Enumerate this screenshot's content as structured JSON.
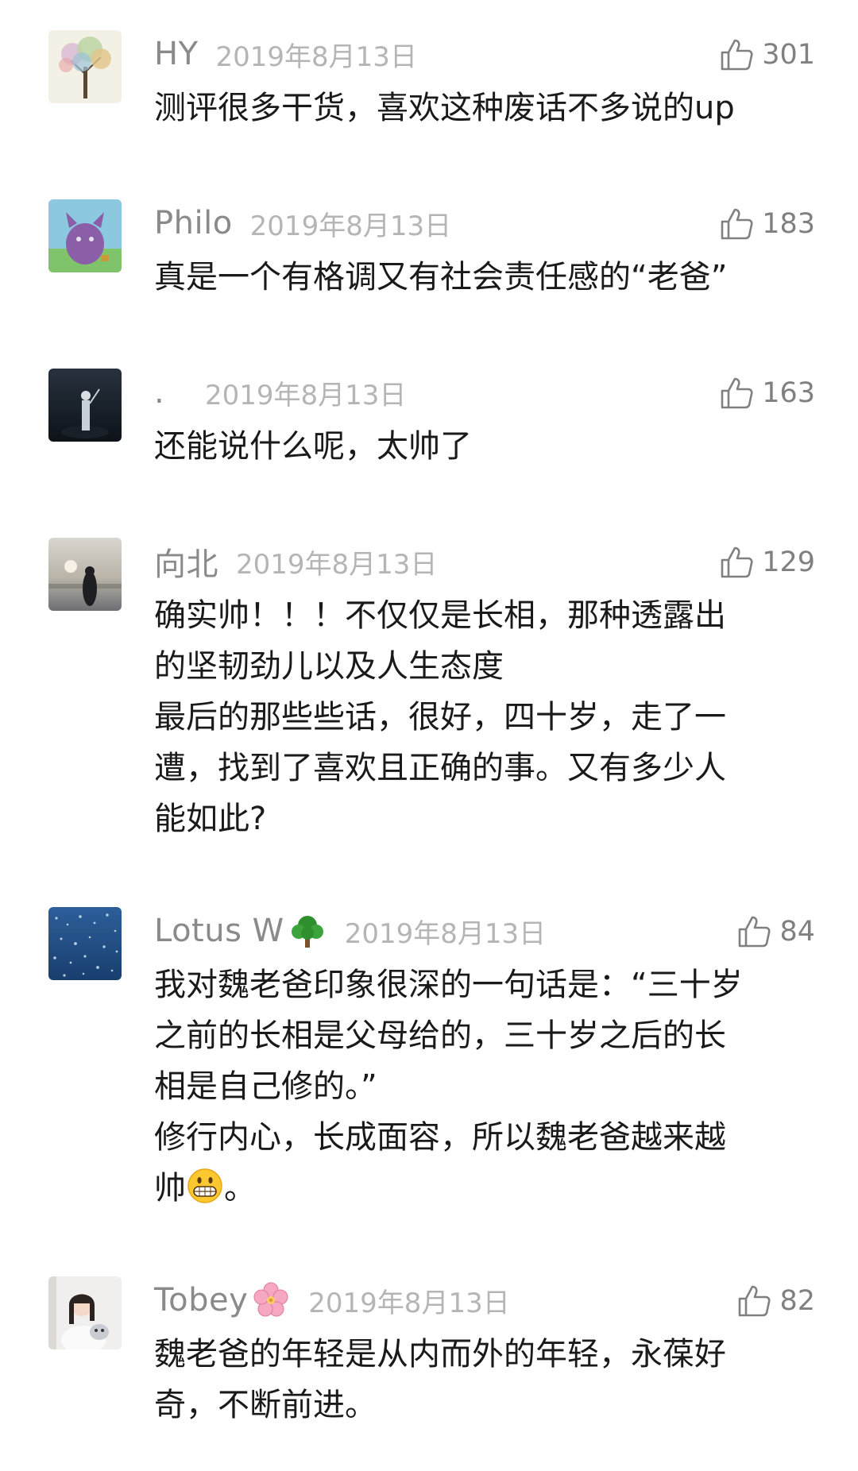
{
  "comments": [
    {
      "username": "HY",
      "date": "2019年8月13日",
      "likes": "301",
      "lines": [
        "测评很多干货，喜欢这种废话不多说的up"
      ]
    },
    {
      "username": "Philo",
      "date": "2019年8月13日",
      "likes": "183",
      "lines": [
        "真是一个有格调又有社会责任感的“老爸”"
      ]
    },
    {
      "username": ".",
      "date": "2019年8月13日",
      "likes": "163",
      "lines": [
        "还能说什么呢，太帅了"
      ]
    },
    {
      "username": "向北",
      "date": "2019年8月13日",
      "likes": "129",
      "lines": [
        "确实帅！！！不仅仅是长相，那种透露出",
        "的坚韧劲儿以及人生态度",
        "最后的那些些话，很好，四十岁，走了一",
        "遭，找到了喜欢且正确的事。又有多少人",
        "能如此?"
      ]
    },
    {
      "username": "Lotus W",
      "username_emoji": "tree-emoji",
      "date": "2019年8月13日",
      "likes": "84",
      "lines": [
        "我对魏老爸印象很深的一句话是：“三十岁",
        "之前的长相是父母给的，三十岁之后的长",
        "相是自己修的。”",
        "修行内心，长成面容，所以魏老爸越来越",
        "帅",
        "。"
      ],
      "inline_emoji": "grinning-face-emoji"
    },
    {
      "username": "Tobey",
      "username_emoji": "cherry-blossom-emoji",
      "date": "2019年8月13日",
      "likes": "82",
      "lines": [
        "魏老爸的年轻是从内而外的年轻，永葆好",
        "奇，不断前进。"
      ]
    }
  ],
  "icons": {
    "like": "thumbs-up-icon"
  },
  "colors": {
    "username": "#8a8a8a",
    "date": "#b5b5b5",
    "text": "#1a1a1a",
    "like": "#808080"
  }
}
